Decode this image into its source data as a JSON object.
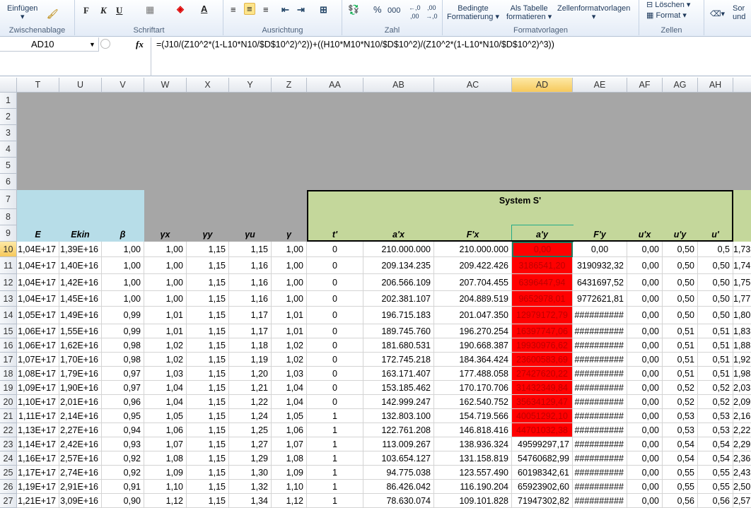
{
  "ribbon": {
    "groups": [
      {
        "label": "Zwischenablage"
      },
      {
        "label": "Schriftart"
      },
      {
        "label": "Ausrichtung"
      },
      {
        "label": "Zahl"
      },
      {
        "label": "Formatvorlagen"
      },
      {
        "label": "Zellen"
      }
    ],
    "paste": "Einfügen",
    "bold": "F",
    "italic": "K",
    "underline": "U",
    "percent": "%",
    "thousands": "000",
    "cond_format": [
      "Bedingte",
      "Formatierung ▾"
    ],
    "as_table": [
      "Als Tabelle",
      "formatieren ▾"
    ],
    "cell_styles": "Zellenformatvorlagen",
    "delete": "Löschen ▾",
    "format": "Format ▾",
    "sort": [
      "Sor",
      "und"
    ]
  },
  "formula_bar": {
    "name_box": "AD10",
    "fx": "fx",
    "formula": "=(J10/(Z10^2*(1-L10*N10/$D$10^2)^2))+((H10*M10*N10/$D$10^2)/(Z10^2*(1-L10*N10/$D$10^2)^3))"
  },
  "columns": [
    "T",
    "U",
    "V",
    "W",
    "X",
    "Y",
    "Z",
    "AA",
    "AB",
    "AC",
    "AD",
    "AE",
    "AF",
    "AG",
    "AH",
    ""
  ],
  "selected_column": "AD",
  "selected_cell": "AD10",
  "system_label": "System S'",
  "headers": [
    "E",
    "Ekin",
    "β",
    "γx",
    "γy",
    "γu",
    "γ",
    "t'",
    "a'x",
    "F'x",
    "a'y",
    "F'y",
    "u'x",
    "u'y",
    "u'",
    ""
  ],
  "colors": {
    "header_blue": "#b7dde8",
    "system_green": "#c4d79b",
    "gray_fill": "#a6a6a6",
    "highlight_red": "#ff0000"
  },
  "rows": [
    {
      "n": "10",
      "v": [
        "1,04E+17",
        "1,39E+16",
        "1,00",
        "1,00",
        "1,15",
        "1,15",
        "1,00",
        "0",
        "210.000.000",
        "210.000.000",
        "0,00",
        "0,00",
        "0,00",
        "0,50",
        "0,5",
        "1,73"
      ]
    },
    {
      "n": "11",
      "v": [
        "1,04E+17",
        "1,40E+16",
        "1,00",
        "1,00",
        "1,15",
        "1,16",
        "1,00",
        "0",
        "209.134.235",
        "209.422.426",
        "3186541,20",
        "3190932,32",
        "0,00",
        "0,50",
        "0,50",
        "1,74"
      ]
    },
    {
      "n": "12",
      "v": [
        "1,04E+17",
        "1,42E+16",
        "1,00",
        "1,00",
        "1,15",
        "1,16",
        "1,00",
        "0",
        "206.566.109",
        "207.704.455",
        "6396447,94",
        "6431697,52",
        "0,00",
        "0,50",
        "0,50",
        "1,75"
      ]
    },
    {
      "n": "13",
      "v": [
        "1,04E+17",
        "1,45E+16",
        "1,00",
        "1,00",
        "1,15",
        "1,16",
        "1,00",
        "0",
        "202.381.107",
        "204.889.519",
        "9652978,01",
        "9772621,81",
        "0,00",
        "0,50",
        "0,50",
        "1,77"
      ]
    },
    {
      "n": "14",
      "v": [
        "1,05E+17",
        "1,49E+16",
        "0,99",
        "1,01",
        "1,15",
        "1,17",
        "1,01",
        "0",
        "196.715.183",
        "201.047.350",
        "12979172,79",
        "##########",
        "0,00",
        "0,50",
        "0,50",
        "1,80"
      ]
    },
    {
      "n": "15",
      "v": [
        "1,06E+17",
        "1,55E+16",
        "0,99",
        "1,01",
        "1,15",
        "1,17",
        "1,01",
        "0",
        "189.745.760",
        "196.270.254",
        "16397747,06",
        "##########",
        "0,00",
        "0,51",
        "0,51",
        "1,83"
      ]
    },
    {
      "n": "16",
      "v": [
        "1,06E+17",
        "1,62E+16",
        "0,98",
        "1,02",
        "1,15",
        "1,18",
        "1,02",
        "0",
        "181.680.531",
        "190.668.387",
        "19930976,62",
        "##########",
        "0,00",
        "0,51",
        "0,51",
        "1,88"
      ]
    },
    {
      "n": "17",
      "v": [
        "1,07E+17",
        "1,70E+16",
        "0,98",
        "1,02",
        "1,15",
        "1,19",
        "1,02",
        "0",
        "172.745.218",
        "184.364.424",
        "23600583,69",
        "##########",
        "0,00",
        "0,51",
        "0,51",
        "1,92"
      ]
    },
    {
      "n": "18",
      "v": [
        "1,08E+17",
        "1,79E+16",
        "0,97",
        "1,03",
        "1,15",
        "1,20",
        "1,03",
        "0",
        "163.171.407",
        "177.488.058",
        "27427620,22",
        "##########",
        "0,00",
        "0,51",
        "0,51",
        "1,98"
      ]
    },
    {
      "n": "19",
      "v": [
        "1,09E+17",
        "1,90E+16",
        "0,97",
        "1,04",
        "1,15",
        "1,21",
        "1,04",
        "0",
        "153.185.462",
        "170.170.706",
        "31432349,84",
        "##########",
        "0,00",
        "0,52",
        "0,52",
        "2,03"
      ]
    },
    {
      "n": "20",
      "v": [
        "1,10E+17",
        "2,01E+16",
        "0,96",
        "1,04",
        "1,15",
        "1,22",
        "1,04",
        "0",
        "142.999.247",
        "162.540.752",
        "35634129,47",
        "##########",
        "0,00",
        "0,52",
        "0,52",
        "2,09"
      ]
    },
    {
      "n": "21",
      "v": [
        "1,11E+17",
        "2,14E+16",
        "0,95",
        "1,05",
        "1,15",
        "1,24",
        "1,05",
        "1",
        "132.803.100",
        "154.719.566",
        "40051292,10",
        "##########",
        "0,00",
        "0,53",
        "0,53",
        "2,16"
      ]
    },
    {
      "n": "22",
      "v": [
        "1,13E+17",
        "2,27E+16",
        "0,94",
        "1,06",
        "1,15",
        "1,25",
        "1,06",
        "1",
        "122.761.208",
        "146.818.416",
        "44701032,38",
        "##########",
        "0,00",
        "0,53",
        "0,53",
        "2,22"
      ]
    },
    {
      "n": "23",
      "v": [
        "1,14E+17",
        "2,42E+16",
        "0,93",
        "1,07",
        "1,15",
        "1,27",
        "1,07",
        "1",
        "113.009.267",
        "138.936.324",
        "49599297,17",
        "##########",
        "0,00",
        "0,54",
        "0,54",
        "2,29"
      ]
    },
    {
      "n": "24",
      "v": [
        "1,16E+17",
        "2,57E+16",
        "0,92",
        "1,08",
        "1,15",
        "1,29",
        "1,08",
        "1",
        "103.654.127",
        "131.158.819",
        "54760682,99",
        "##########",
        "0,00",
        "0,54",
        "0,54",
        "2,36"
      ]
    },
    {
      "n": "25",
      "v": [
        "1,17E+17",
        "2,74E+16",
        "0,92",
        "1,09",
        "1,15",
        "1,30",
        "1,09",
        "1",
        "94.775.038",
        "123.557.490",
        "60198342,61",
        "##########",
        "0,00",
        "0,55",
        "0,55",
        "2,43"
      ]
    },
    {
      "n": "26",
      "v": [
        "1,19E+17",
        "2,91E+16",
        "0,91",
        "1,10",
        "1,15",
        "1,32",
        "1,10",
        "1",
        "86.426.042",
        "116.190.204",
        "65923902,60",
        "##########",
        "0,00",
        "0,55",
        "0,55",
        "2,50"
      ]
    },
    {
      "n": "27",
      "v": [
        "1,21E+17",
        "3,09E+16",
        "0,90",
        "1,12",
        "1,15",
        "1,34",
        "1,12",
        "1",
        "78.630.074",
        "109.101.828",
        "71947302,82",
        "##########",
        "0,00",
        "0,56",
        "0,56",
        "2,57"
      ]
    }
  ]
}
